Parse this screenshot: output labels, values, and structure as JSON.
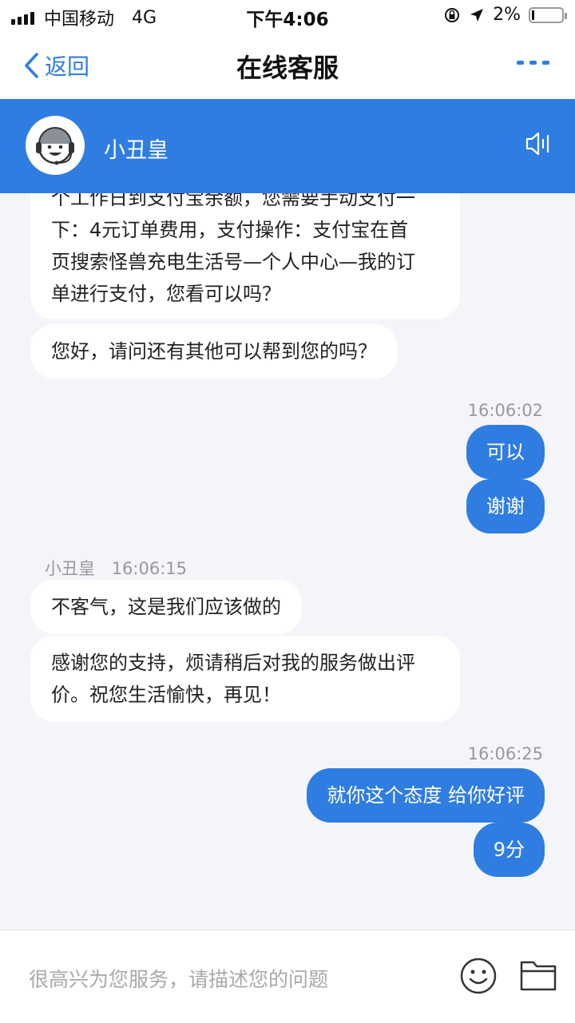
{
  "status_bar": {
    "carrier": "中国移动",
    "network": "4G",
    "time": "下午4:06",
    "battery": "2%"
  },
  "nav": {
    "back_label": "返回",
    "title": "在线客服"
  },
  "agent": {
    "name": "小丑皇"
  },
  "messages": [
    {
      "side": "in",
      "text_lines": [
        "个工作日到支付宝余额，您需要手动支付一",
        "下：4元订单费用，支付操作：支付宝在首",
        "页搜索怪兽充电生活号—个人中心—我的订",
        "单进行支付，您看可以吗？"
      ]
    },
    {
      "side": "in",
      "text": "您好，请问还有其他可以帮到您的吗？"
    },
    {
      "side": "out",
      "time": "16:06:02"
    },
    {
      "side": "out",
      "text": "可以"
    },
    {
      "side": "out",
      "text": "谢谢"
    },
    {
      "side": "in",
      "sender": "小丑皇",
      "time": "16:06:15"
    },
    {
      "side": "in",
      "text": "不客气，这是我们应该做的"
    },
    {
      "side": "in",
      "text_lines": [
        "感谢您的支持，烦请稍后对我的服务做出评",
        "价。祝您生活愉快，再见！"
      ]
    },
    {
      "side": "out",
      "time": "16:06:25"
    },
    {
      "side": "out",
      "text": "就你这个态度 给你好评"
    },
    {
      "side": "out",
      "text": "9分"
    }
  ],
  "input": {
    "placeholder": "很高兴为您服务，请描述您的问题"
  },
  "icons": [
    "signal-icon",
    "location-arrow-icon",
    "rotation-lock-icon",
    "battery-icon",
    "back-chevron-icon",
    "more-dots-icon",
    "agent-avatar-icon",
    "speaker-icon",
    "emoji-icon",
    "folder-icon"
  ],
  "colors": {
    "accent": "#2f7de1",
    "background": "#f3f5f9"
  }
}
